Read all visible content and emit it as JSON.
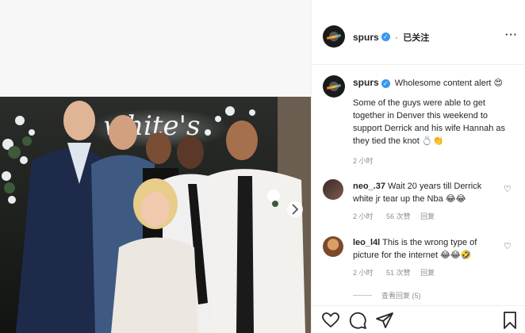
{
  "header": {
    "username": "spurs",
    "follow_label": "已关注",
    "more_label": "···"
  },
  "caption": {
    "username": "spurs",
    "headline": "Wholesome content alert 😍",
    "body": "Some of the guys were able to get together in Denver this weekend to support Derrick and his wife Hannah as they tied the knot 💍👏",
    "time": "2 小时"
  },
  "comments": [
    {
      "username": "neo_.37",
      "text": "Wait 20 years till Derrick white jr tear up the Nba 😂😂",
      "time": "2 小时",
      "likes": "56 次赞",
      "reply_label": "回复"
    },
    {
      "username": "leo_l4l",
      "text": "This is the wrong type of picture for the internet 😂😂🤣",
      "time": "2 小时",
      "likes": "51 次赞",
      "reply_label": "回复"
    }
  ],
  "view_replies_label": "查看回复 (5)",
  "photo": {
    "neon_sign": "white's"
  },
  "icons": {
    "like": "heart-icon",
    "comment": "comment-icon",
    "share": "share-icon",
    "save": "bookmark-icon",
    "verified": "verified-badge-icon",
    "next": "chevron-right-icon"
  },
  "colors": {
    "verified": "#3897f0",
    "muted": "#8e8e8e",
    "text": "#262626"
  }
}
